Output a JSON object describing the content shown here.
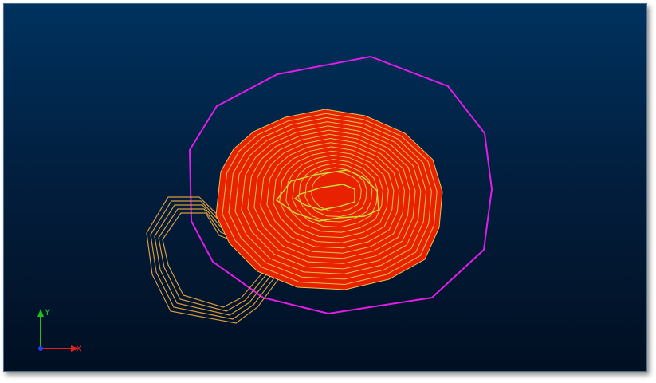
{
  "viewport": {
    "background_top": "#00325f",
    "background_bottom": "#010f22"
  },
  "model": {
    "boundary_color": "#e01ee8",
    "contour_fill": "#e82200",
    "contour_line": "#e8c050",
    "inner_contour_line": "#c8e030",
    "side_contour_line": "#d89a40"
  },
  "axes": {
    "x_label": "X",
    "y_label": "Y",
    "x_color": "#e02020",
    "y_color": "#20c020",
    "z_color": "#2040ff"
  }
}
